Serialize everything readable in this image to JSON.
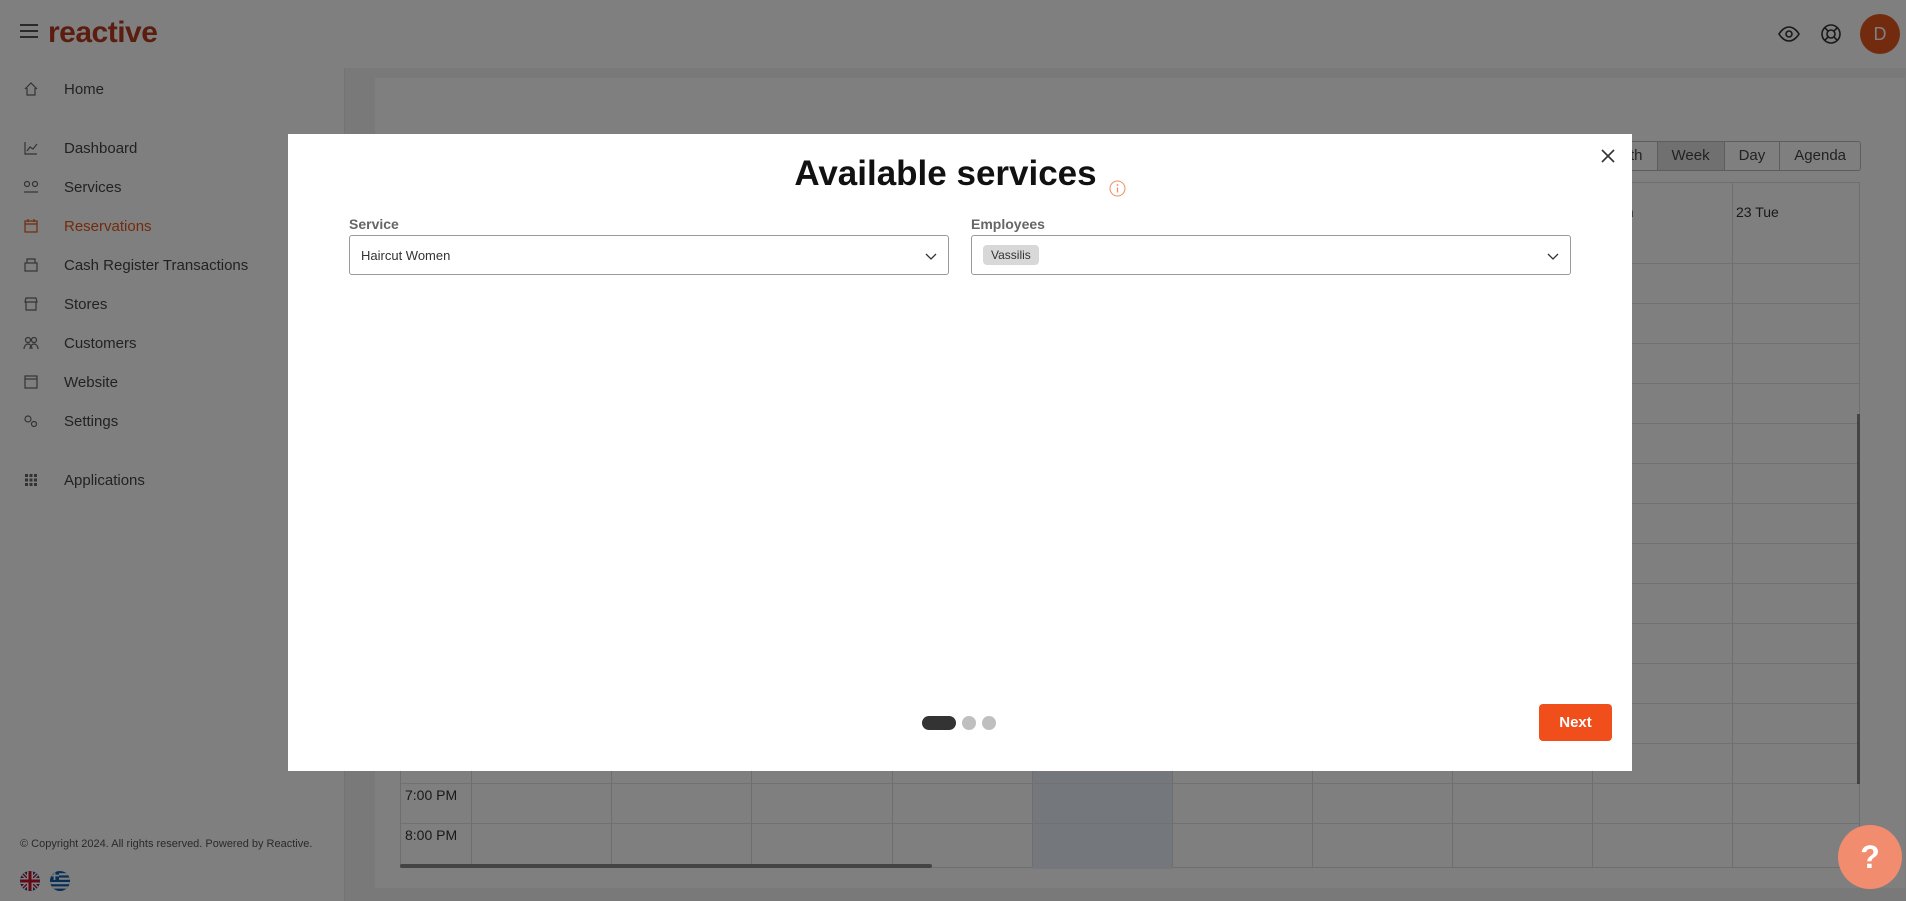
{
  "app": {
    "logo_text": "reactive",
    "brand_color": "#e4561c"
  },
  "topbar": {
    "icons": [
      "eye-icon",
      "lifebuoy-icon"
    ],
    "avatar_initial": "D"
  },
  "sidebar": {
    "items": [
      {
        "label": "Home",
        "icon": "home-icon"
      },
      {
        "label": "Dashboard",
        "icon": "chart-icon"
      },
      {
        "label": "Services",
        "icon": "services-icon"
      },
      {
        "label": "Reservations",
        "icon": "calendar-icon",
        "active": true
      },
      {
        "label": "Cash Register Transactions",
        "icon": "register-icon"
      },
      {
        "label": "Stores",
        "icon": "store-icon"
      },
      {
        "label": "Customers",
        "icon": "customers-icon"
      },
      {
        "label": "Website",
        "icon": "website-icon"
      },
      {
        "label": "Settings",
        "icon": "settings-icon"
      },
      {
        "label": "Applications",
        "icon": "apps-icon"
      }
    ],
    "copyright": "© Copyright 2024. All rights reserved. Powered by Reactive."
  },
  "calendar": {
    "views": [
      "th",
      "Week",
      "Day",
      "Agenda"
    ],
    "active_view": "Week",
    "day_headers": [
      "on",
      "23 Tue"
    ],
    "time_labels": [
      "7:00 PM",
      "8:00 PM"
    ]
  },
  "modal": {
    "title": "Available services",
    "service": {
      "label": "Service",
      "value": "Haircut Women"
    },
    "employees": {
      "label": "Employees",
      "chips": [
        "Vassilis"
      ]
    },
    "steps": {
      "total": 3,
      "current": 1
    },
    "next_label": "Next"
  },
  "help": {
    "label": "?"
  }
}
